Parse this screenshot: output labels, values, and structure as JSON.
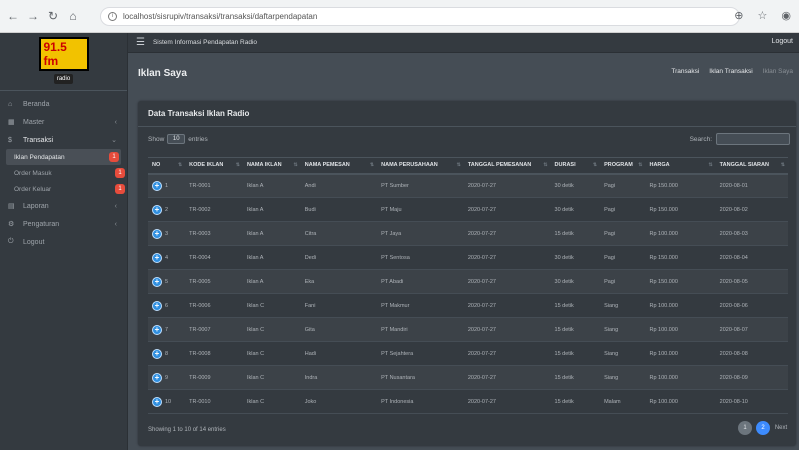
{
  "browser": {
    "url": "localhost/sisrupiv/transaksi/transaksi/daftarpendapatan"
  },
  "sidebar": {
    "logo": {
      "freq": "91.5 fm",
      "sub": "radio"
    },
    "items": [
      {
        "label": "Beranda",
        "icon": "home-icon"
      },
      {
        "label": "Master",
        "icon": "grid-icon"
      },
      {
        "label": "Transaksi",
        "icon": "money-icon"
      },
      {
        "label": "Laporan",
        "icon": "file-icon"
      },
      {
        "label": "Pengaturan",
        "icon": "gear-icon"
      },
      {
        "label": "Logout",
        "icon": "logout-icon"
      }
    ],
    "submenu": [
      {
        "label": "Iklan Pendapatan",
        "badge": "1"
      },
      {
        "label": "Order Masuk",
        "badge": "1"
      },
      {
        "label": "Order Keluar",
        "badge": "1"
      }
    ]
  },
  "topbar": {
    "title": "Sistem Informasi Pendapatan Radio",
    "logout": "Logout"
  },
  "header": {
    "page_title": "Iklan Saya",
    "breadcrumb": [
      "Transaksi",
      "Iklan Transaksi",
      "Iklan Saya"
    ]
  },
  "card": {
    "title": "Data Transaksi Iklan Radio",
    "show_label": "Show",
    "show_value": "10",
    "entries_label": "entries",
    "search_label": "Search:"
  },
  "table": {
    "columns": [
      "NO",
      "KODE IKLAN",
      "NAMA IKLAN",
      "NAMA PEMESAN",
      "NAMA PERUSAHAAN",
      "TANGGAL PEMESANAN",
      "DURASI",
      "PROGRAM",
      "HARGA",
      "TANGGAL SIARAN"
    ],
    "rows": [
      [
        "1",
        "TR-0001",
        "Iklan A",
        "Andi",
        "PT Sumber",
        "2020-07-27",
        "30 detik",
        "Pagi",
        "Rp 150.000",
        "2020-08-01"
      ],
      [
        "2",
        "TR-0002",
        "Iklan A",
        "Budi",
        "PT Maju",
        "2020-07-27",
        "30 detik",
        "Pagi",
        "Rp 150.000",
        "2020-08-02"
      ],
      [
        "3",
        "TR-0003",
        "Iklan A",
        "Citra",
        "PT Jaya",
        "2020-07-27",
        "15 detik",
        "Pagi",
        "Rp 100.000",
        "2020-08-03"
      ],
      [
        "4",
        "TR-0004",
        "Iklan A",
        "Dedi",
        "PT Sentosa",
        "2020-07-27",
        "30 detik",
        "Pagi",
        "Rp 150.000",
        "2020-08-04"
      ],
      [
        "5",
        "TR-0005",
        "Iklan A",
        "Eka",
        "PT Abadi",
        "2020-07-27",
        "30 detik",
        "Pagi",
        "Rp 150.000",
        "2020-08-05"
      ],
      [
        "6",
        "TR-0006",
        "Iklan C",
        "Fani",
        "PT Makmur",
        "2020-07-27",
        "15 detik",
        "Siang",
        "Rp 100.000",
        "2020-08-06"
      ],
      [
        "7",
        "TR-0007",
        "Iklan C",
        "Gita",
        "PT Mandiri",
        "2020-07-27",
        "15 detik",
        "Siang",
        "Rp 100.000",
        "2020-08-07"
      ],
      [
        "8",
        "TR-0008",
        "Iklan C",
        "Hadi",
        "PT Sejahtera",
        "2020-07-27",
        "15 detik",
        "Siang",
        "Rp 100.000",
        "2020-08-08"
      ],
      [
        "9",
        "TR-0009",
        "Iklan C",
        "Indra",
        "PT Nusantara",
        "2020-07-27",
        "15 detik",
        "Siang",
        "Rp 100.000",
        "2020-08-09"
      ],
      [
        "10",
        "TR-0010",
        "Iklan C",
        "Joko",
        "PT Indonesia",
        "2020-07-27",
        "15 detik",
        "Malam",
        "Rp 100.000",
        "2020-08-10"
      ]
    ]
  },
  "footer": {
    "showing": "Showing 1 to 10 of 14 entries",
    "pages": [
      "1",
      "2",
      "Next"
    ]
  },
  "colors": {
    "background": "#454d55",
    "sidebar": "#343a40",
    "accent": "#3d8bfd",
    "badge": "#e74c3c"
  }
}
